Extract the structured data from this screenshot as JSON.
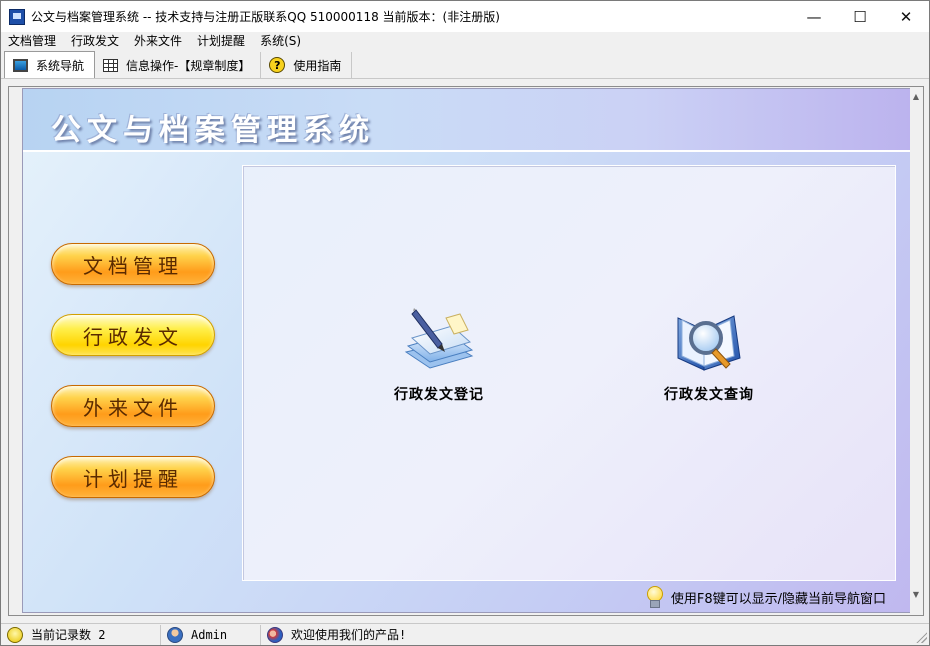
{
  "window": {
    "title": "公文与档案管理系统 -- 技术支持与注册正版联系QQ 510000118    当前版本：(非注册版)",
    "minimize": "—",
    "maximize": "☐",
    "close": "✕"
  },
  "menubar": {
    "items": [
      "文档管理",
      "行政发文",
      "外来文件",
      "计划提醒",
      "系统(S)"
    ]
  },
  "toolbar": {
    "tabs": [
      {
        "label": "系统导航",
        "icon": "monitor-icon",
        "active": true
      },
      {
        "label": "信息操作-【规章制度】",
        "icon": "grid-icon",
        "active": false
      },
      {
        "label": "使用指南",
        "icon": "help-icon",
        "active": false
      }
    ]
  },
  "banner": {
    "title": "公文与档案管理系统"
  },
  "nav_buttons": [
    {
      "label": "文档管理",
      "color": "#ff9c1a"
    },
    {
      "label": "行政发文",
      "color": "#ffd400"
    },
    {
      "label": "外来文件",
      "color": "#ff9c1a"
    },
    {
      "label": "计划提醒",
      "color": "#ff9c1a"
    }
  ],
  "actions": [
    {
      "label": "行政发文登记",
      "icon": "document-pen-icon"
    },
    {
      "label": "行政发文查询",
      "icon": "book-magnifier-icon"
    }
  ],
  "hint": {
    "text": "使用F8键可以显示/隐藏当前导航窗口",
    "icon": "lightbulb-icon"
  },
  "statusbar": {
    "records": "当前记录数 2",
    "user": "Admin",
    "message": "欢迎使用我们的产品!"
  }
}
